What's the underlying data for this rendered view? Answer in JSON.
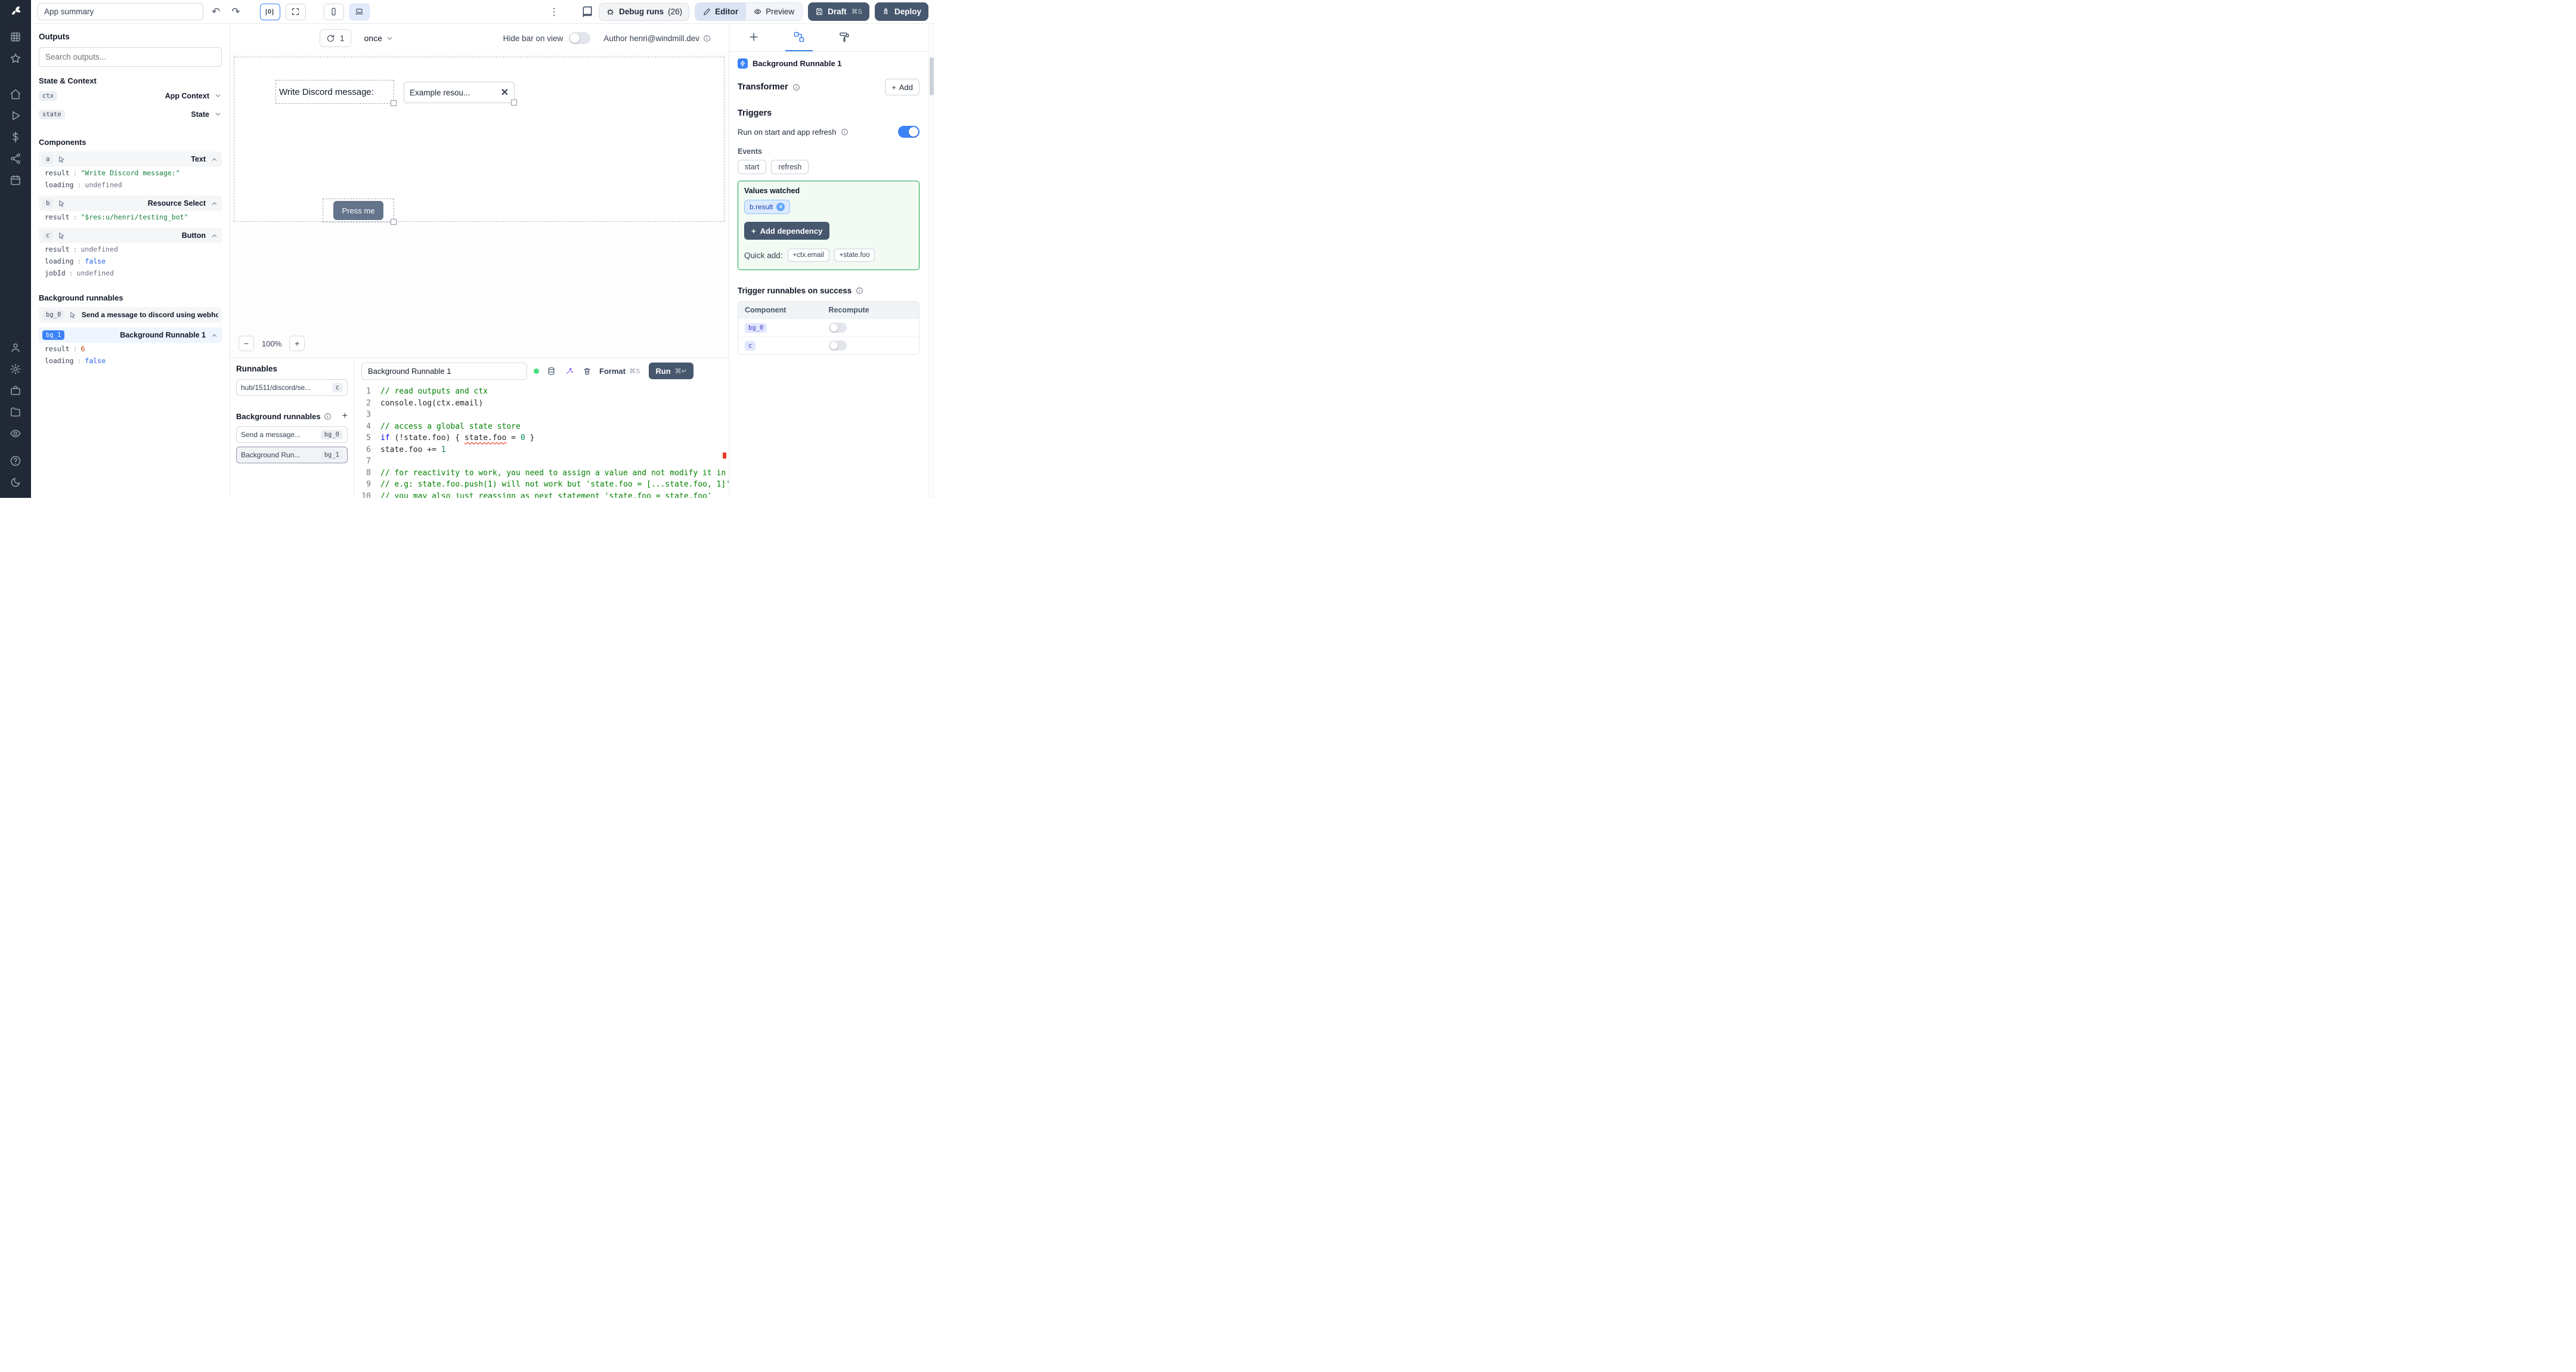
{
  "topbar": {
    "app_summary": "App summary",
    "align_button": "|0|",
    "debug_runs_label": "Debug runs",
    "debug_runs_count": "(26)",
    "editor_label": "Editor",
    "preview_label": "Preview",
    "draft_label": "Draft",
    "draft_shortcut": "⌘S",
    "deploy_label": "Deploy"
  },
  "sidebar": {
    "icons": [
      "windmill-logo",
      "apps",
      "favorites",
      "home",
      "runs",
      "variables",
      "resources",
      "schedules",
      "user",
      "settings",
      "workers",
      "folders",
      "audit",
      "help",
      "theme"
    ]
  },
  "outputs": {
    "title": "Outputs",
    "search_placeholder": "Search outputs...",
    "state_context_title": "State & Context",
    "ctx_badge": "ctx",
    "ctx_type": "App Context",
    "state_badge": "state",
    "state_type": "State",
    "components_title": "Components",
    "components": [
      {
        "id": "a",
        "type": "Text",
        "props": [
          {
            "key": "result",
            "value": "\"Write Discord message:\"",
            "kind": "string"
          },
          {
            "key": "loading",
            "value": "undefined",
            "kind": "undefined"
          }
        ]
      },
      {
        "id": "b",
        "type": "Resource Select",
        "props": [
          {
            "key": "result",
            "value": "\"$res:u/henri/testing_bot\"",
            "kind": "string"
          }
        ]
      },
      {
        "id": "c",
        "type": "Button",
        "props": [
          {
            "key": "result",
            "value": "undefined",
            "kind": "undefined"
          },
          {
            "key": "loading",
            "value": "false",
            "kind": "boolean"
          },
          {
            "key": "jobId",
            "value": "undefined",
            "kind": "undefined"
          }
        ]
      }
    ],
    "background_title": "Background runnables",
    "bg0_badge": "bg_0",
    "bg0_label": "Send a message to discord using webhoo",
    "bg1_badge": "bg_1",
    "bg1_label": "Background Runnable 1",
    "bg1_props": [
      {
        "key": "result",
        "value": "6",
        "kind": "number"
      },
      {
        "key": "loading",
        "value": "false",
        "kind": "boolean"
      }
    ]
  },
  "canvas_toolbar": {
    "refresh_count": "1",
    "schedule": "once",
    "hide_bar_label": "Hide bar on view",
    "author": "Author henri@windmill.dev"
  },
  "canvas": {
    "text_component": "Write Discord message:",
    "select_value": "Example resou...",
    "button_label": "Press me",
    "zoom_out": "−",
    "zoom_level": "100%",
    "zoom_in": "+"
  },
  "runnables": {
    "title": "Runnables",
    "items": [
      {
        "label": "hub/1511/discord/se...",
        "badge": "c"
      }
    ],
    "background_title": "Background runnables",
    "background_items": [
      {
        "label": "Send a message...",
        "badge": "bg_0"
      },
      {
        "label": "Background Run...",
        "badge": "bg_1",
        "selected": true
      }
    ]
  },
  "editor": {
    "name": "Background Runnable 1",
    "format_label": "Format",
    "format_shortcut": "⌘S",
    "run_label": "Run",
    "run_shortcut": "⌘↵",
    "lines": [
      {
        "n": "1",
        "segs": [
          {
            "t": "// read outputs and ctx",
            "c": "cmt"
          }
        ]
      },
      {
        "n": "2",
        "segs": [
          {
            "t": "console.log(ctx.email)",
            "c": "plain"
          }
        ]
      },
      {
        "n": "3",
        "segs": []
      },
      {
        "n": "4",
        "segs": [
          {
            "t": "// access a global state store",
            "c": "cmt"
          }
        ]
      },
      {
        "n": "5",
        "segs": [
          {
            "t": "if",
            "c": "kw"
          },
          {
            "t": " (!state.foo) { ",
            "c": "plain"
          },
          {
            "t": "state.foo",
            "c": "plain err"
          },
          {
            "t": " = ",
            "c": "plain"
          },
          {
            "t": "0",
            "c": "num"
          },
          {
            "t": " }",
            "c": "plain"
          }
        ]
      },
      {
        "n": "6",
        "segs": [
          {
            "t": "state.foo += ",
            "c": "plain"
          },
          {
            "t": "1",
            "c": "num"
          }
        ]
      },
      {
        "n": "7",
        "segs": []
      },
      {
        "n": "8",
        "segs": [
          {
            "t": "// for reactivity to work, you need to assign a value and not modify it in p",
            "c": "cmt"
          }
        ]
      },
      {
        "n": "9",
        "segs": [
          {
            "t": "// e.g: state.foo.push(1) will not work but 'state.foo = [...state.foo, 1]'",
            "c": "cmt"
          }
        ]
      },
      {
        "n": "10",
        "segs": [
          {
            "t": "// you may also just reassign as next statement 'state.foo = state.foo'",
            "c": "cmt"
          }
        ]
      }
    ]
  },
  "inspector": {
    "header": "Background Runnable 1",
    "transformer_title": "Transformer",
    "add_label": "Add",
    "triggers_title": "Triggers",
    "run_on_start_label": "Run on start and app refresh",
    "events_label": "Events",
    "events": [
      "start",
      "refresh"
    ],
    "values_watched_title": "Values watched",
    "watched": [
      "b.result"
    ],
    "add_dependency_label": "Add dependency",
    "quick_add_label": "Quick add:",
    "quick_adds": [
      "+ctx.email",
      "+state.foo"
    ],
    "on_success_title": "Trigger runnables on success",
    "table_columns": [
      "Component",
      "Recompute"
    ],
    "table_rows": [
      {
        "component": "bg_0"
      },
      {
        "component": "c"
      }
    ]
  },
  "colors": {
    "accent": "#3b82f6",
    "dark_button": "#47586e",
    "string_value": "#15803d",
    "boolean_value": "#2563eb",
    "number_value": "#c2410c",
    "comment": "#008000",
    "error": "#e51400",
    "watched_border": "#16a34a",
    "sidebar_bg": "#212836"
  }
}
